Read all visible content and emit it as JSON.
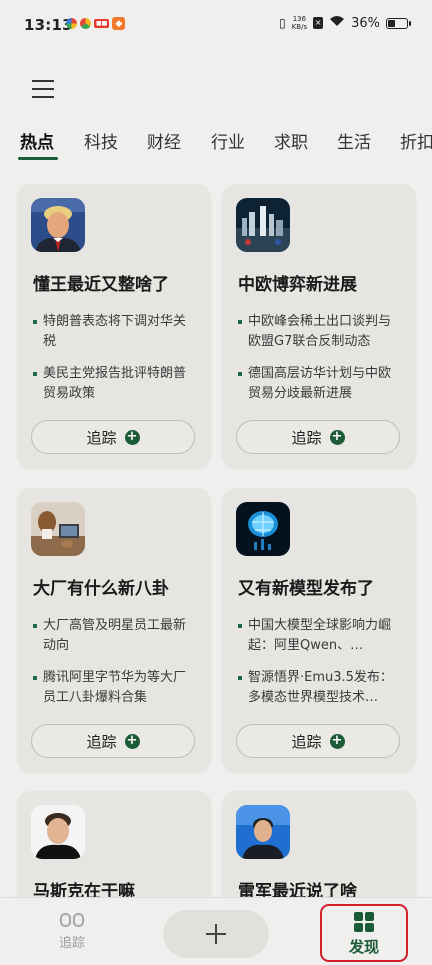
{
  "status_bar": {
    "time": "13:13",
    "net_speed": "136",
    "net_unit": "KB/s",
    "battery": "36%"
  },
  "tabs": [
    "热点",
    "科技",
    "财经",
    "行业",
    "求职",
    "生活",
    "折扣"
  ],
  "cards": [
    {
      "title": "懂王最近又整啥了",
      "bullets": [
        "特朗普表态将下调对华关税",
        "美民主党报告批评特朗普贸易政策"
      ],
      "track_label": "追踪"
    },
    {
      "title": "中欧博弈新进展",
      "bullets": [
        "中欧峰会稀土出口谈判与欧盟G7联合反制动态",
        "德国高层访华计划与中欧贸易分歧最新进展"
      ],
      "track_label": "追踪"
    },
    {
      "title": "大厂有什么新八卦",
      "bullets": [
        "大厂高管及明星员工最新动向",
        "腾讯阿里字节华为等大厂员工八卦爆料合集"
      ],
      "track_label": "追踪"
    },
    {
      "title": "又有新模型发布了",
      "bullets": [
        "中国大模型全球影响力崛起：阿里Qwen、…",
        "智源悟界·Emu3.5发布：多模态世界模型技术…"
      ],
      "track_label": "追踪"
    },
    {
      "title": "马斯克在干嘛"
    },
    {
      "title": "雷军最近说了啥"
    }
  ],
  "bottom_nav": {
    "track_label": "追踪",
    "discover_label": "发现"
  },
  "colors": {
    "accent": "#1b5a36",
    "highlight_border": "#d21f2a",
    "background": "#f0efed",
    "card": "#e6e5e1"
  }
}
